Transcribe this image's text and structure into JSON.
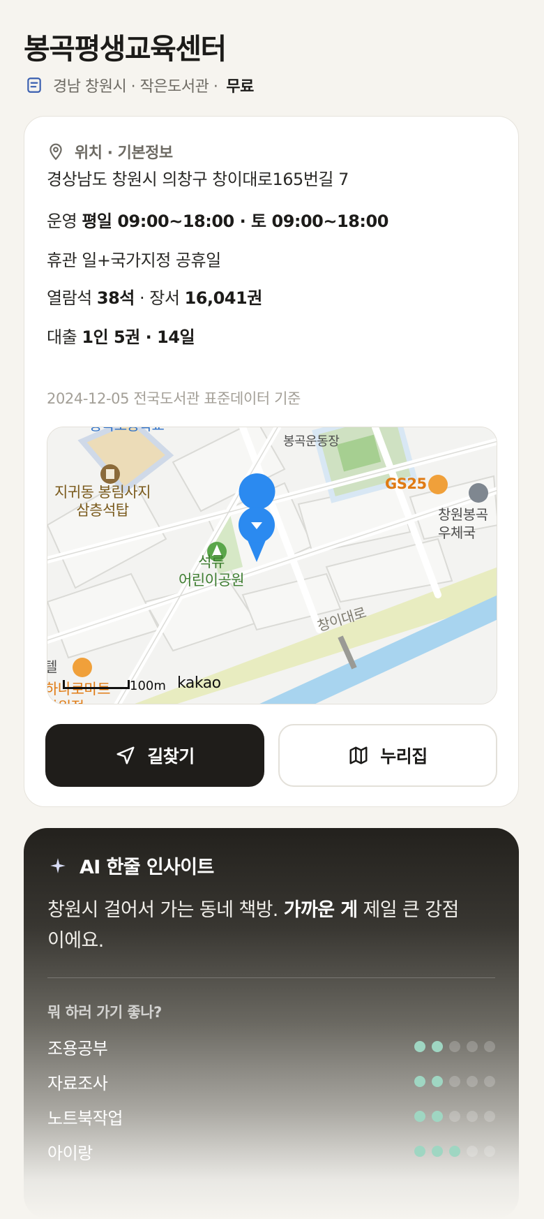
{
  "header": {
    "title": "봉곡평생교육센터",
    "location_meta": "경남 창원시 · 작은도서관 ·",
    "fee": "무료"
  },
  "info_card": {
    "section_title": "위치 · 기본정보",
    "address": "경상남도 창원시 의창구 창이대로165번길 7",
    "hours_label": "운영",
    "hours_value": "평일 09:00~18:00 · 토 09:00~18:00",
    "closed": "휴관 일+국가지정 공휴일",
    "seats_label": "열람석",
    "seats_value": "38석",
    "books_label": "· 장서",
    "books_value": "16,041권",
    "loan_label": "대출",
    "loan_value": "1인 5권 · 14일",
    "source": "2024-12-05 전국도서관 표준데이터 기준"
  },
  "map": {
    "poi_temple": "지귀동 봉림사지\n삼층석탑",
    "poi_park": "석류\n어린이공원",
    "poi_stadium": "봉곡운동장",
    "poi_gs25": "GS25",
    "poi_post": "창원봉곡\n우체국",
    "poi_mart": "하나로마트\n창원점",
    "poi_school_partial": "봉곡초등학교",
    "poi_hotel_partial": "텔",
    "road_main": "창이대로",
    "scale": "100m",
    "brand": "kakao"
  },
  "buttons": {
    "directions": "길찾기",
    "nurijip": "누리집"
  },
  "ai": {
    "title": "AI 한줄 인사이트",
    "text_a": "창원시 걸어서 가는 동네 책방. ",
    "text_bold": "가까운 게",
    "text_b": " 제일 큰 강점이에요.",
    "question": "뭐 하러 가기 좋나?",
    "rows": [
      {
        "label": "조용공부",
        "score": 2
      },
      {
        "label": "자료조사",
        "score": 2
      },
      {
        "label": "노트북작업",
        "score": 2
      },
      {
        "label": "아이랑",
        "score": 3
      }
    ],
    "max_score": 5
  },
  "colors": {
    "background": "#f6f4ef",
    "primary_dark": "#1f1d1a",
    "dot_active": "#9fd6c2",
    "map_pin": "#2b8af0"
  }
}
